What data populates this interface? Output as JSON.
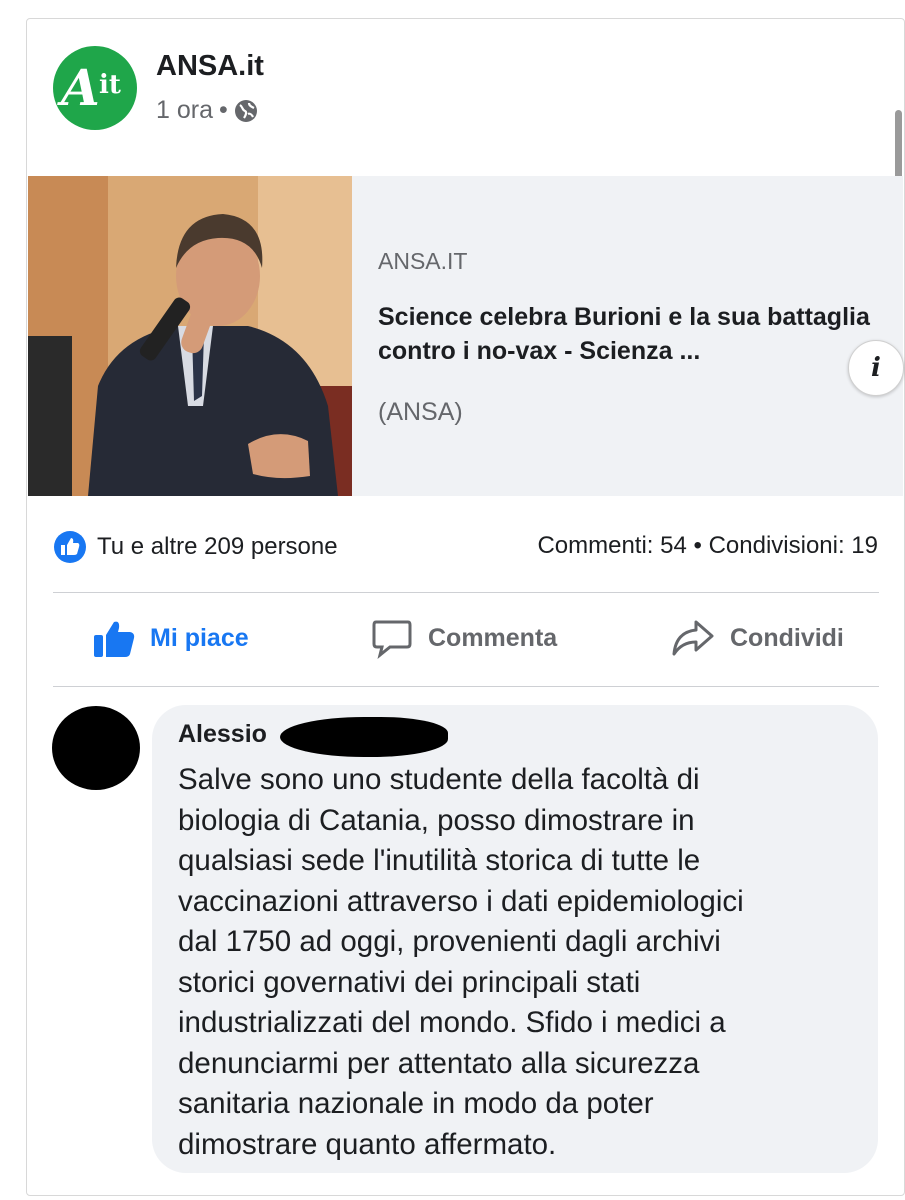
{
  "post": {
    "page_name": "ANSA.it",
    "time": "1 ora",
    "separator": "•",
    "privacy_icon": "globe-icon",
    "avatar": {
      "letter": "A",
      "suffix": "it"
    }
  },
  "link_preview": {
    "domain": "ANSA.IT",
    "headline": "Science celebra Burioni e la sua battaglia contro i no-vax - Scienza ...",
    "description": "(ANSA)",
    "info_label": "i"
  },
  "reactions": {
    "summary": "Tu e altre 209 persone",
    "counts": "Commenti: 54 • Condivisioni: 19"
  },
  "actions": {
    "like": "Mi piace",
    "comment": "Commenta",
    "share": "Condividi"
  },
  "comment": {
    "author": "Alessio",
    "text": "Salve sono uno studente della facoltà di\nbiologia di Catania, posso dimostrare in\nqualsiasi sede l'inutilità storica di tutte le\nvaccinazioni attraverso i dati epidemiologici\ndal 1750 ad oggi, provenienti dagli archivi\nstorici governativi dei principali stati\nindustrializzati del mondo. Sfido i medici a\ndenunciarmi per attentato alla sicurezza\nsanitaria nazionale in modo da poter\ndimostrare quanto affermato."
  },
  "colors": {
    "accent": "#1877f2",
    "text": "#1c1e21",
    "muted": "#65676b",
    "bubble": "#f0f2f5",
    "ansa_green": "#1fa64a"
  }
}
